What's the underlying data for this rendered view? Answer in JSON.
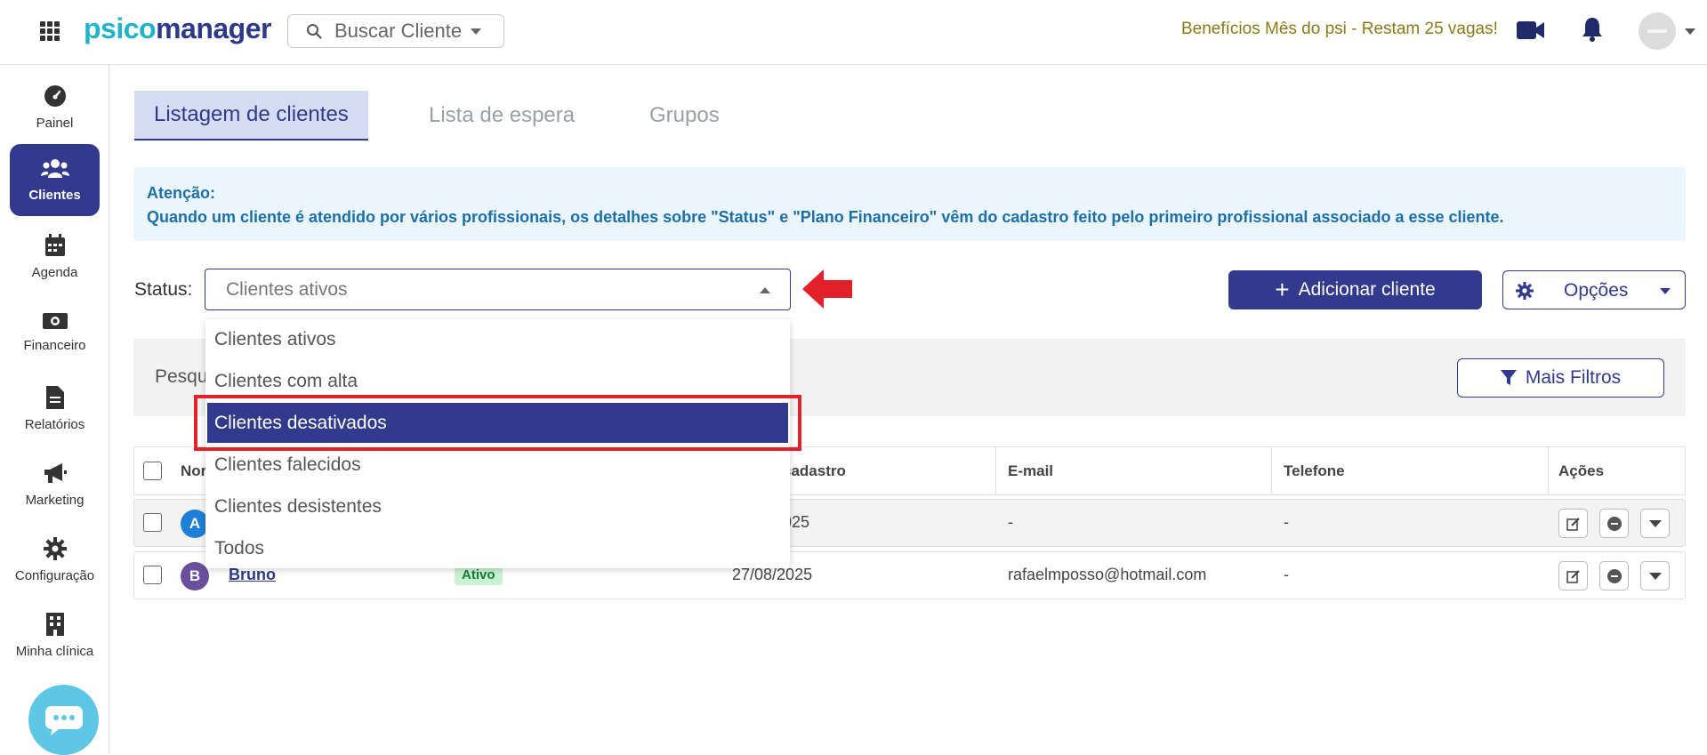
{
  "topbar": {
    "logo_part1": "psico",
    "logo_part2": "manager",
    "search_placeholder": "Buscar Cliente",
    "promo_text": "Benefícios Mês do psi - Restam 25 vagas!"
  },
  "sidebar": {
    "items": [
      {
        "label": "Painel",
        "icon": "gauge-icon"
      },
      {
        "label": "Clientes",
        "icon": "users-icon",
        "active": true
      },
      {
        "label": "Agenda",
        "icon": "calendar-icon"
      },
      {
        "label": "Financeiro",
        "icon": "money-icon"
      },
      {
        "label": "Relatórios",
        "icon": "file-icon"
      },
      {
        "label": "Marketing",
        "icon": "megaphone-icon"
      },
      {
        "label": "Configuração",
        "icon": "gear-icon"
      },
      {
        "label": "Minha clínica",
        "icon": "building-icon"
      }
    ]
  },
  "tabs": [
    {
      "label": "Listagem de clientes",
      "active": true
    },
    {
      "label": "Lista de espera"
    },
    {
      "label": "Grupos"
    }
  ],
  "alert": {
    "title": "Atenção:",
    "message": "Quando um cliente é atendido por vários profissionais, os detalhes sobre \"Status\" e \"Plano Financeiro\" vêm do cadastro feito pelo primeiro profissional associado a esse cliente."
  },
  "status": {
    "label": "Status:",
    "selected": "Clientes ativos",
    "options": [
      "Clientes ativos",
      "Clientes com alta",
      "Clientes desativados",
      "Clientes falecidos",
      "Clientes desistentes",
      "Todos"
    ],
    "highlighted_option": "Clientes desativados"
  },
  "buttons": {
    "add_client": "Adicionar cliente",
    "options": "Opções",
    "more_filters": "Mais Filtros"
  },
  "filter": {
    "search_label_partial": "Pesqu"
  },
  "table": {
    "headers": {
      "name_partial": "Nor",
      "date_partial": "cadastro",
      "email": "E-mail",
      "phone": "Telefone",
      "actions": "Ações"
    },
    "rows": [
      {
        "initial": "A",
        "avatar_color": "#1e7fd6",
        "name": "",
        "status": "",
        "date": "025",
        "email": "-",
        "phone": "-"
      },
      {
        "initial": "B",
        "avatar_color": "#6b4e9e",
        "name": "Bruno",
        "status": "Ativo",
        "date": "27/08/2025",
        "email": "rafaelmposso@hotmail.com",
        "phone": "-"
      }
    ]
  },
  "colors": {
    "primary": "#313a8c",
    "logo_accent": "#1fb4c9",
    "alert_text": "#1d6fa8",
    "highlight": "#e3212b"
  }
}
